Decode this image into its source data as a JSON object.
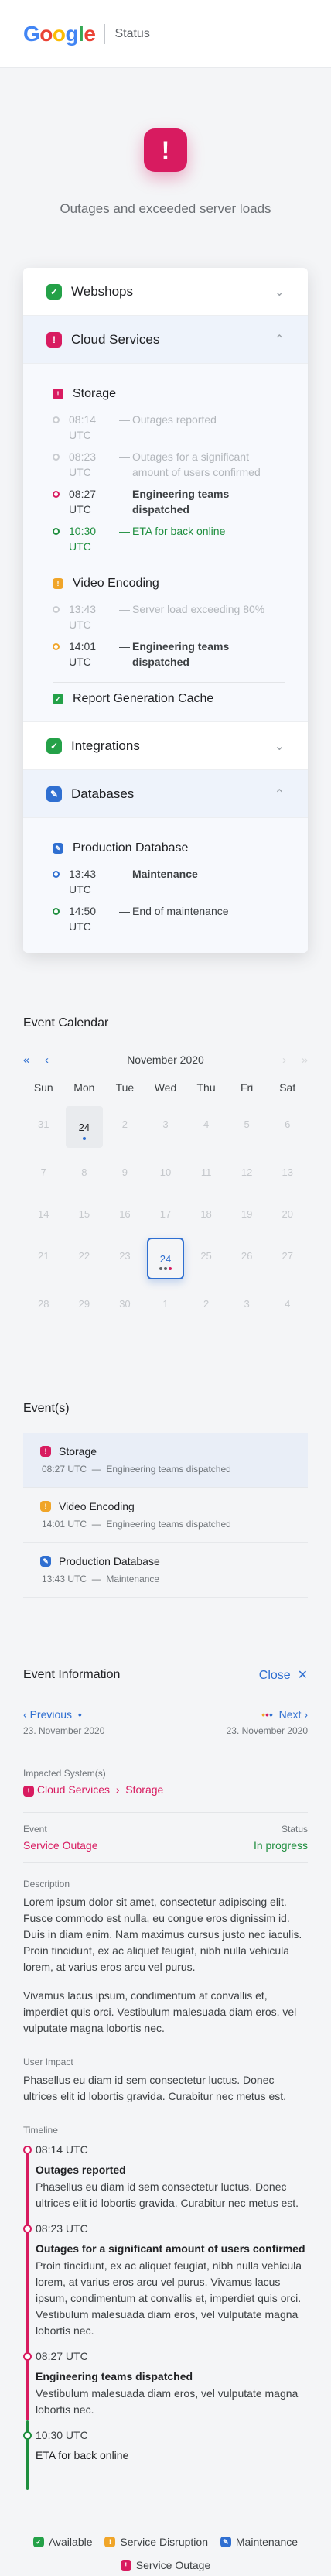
{
  "header": {
    "logo": "Google",
    "title": "Status"
  },
  "logo_colors": [
    "#4285F4",
    "#EA4335",
    "#FBBC05",
    "#4285F4",
    "#34A853",
    "#EA4335"
  ],
  "hero": {
    "icon_text": "!",
    "message": "Outages and exceeded server loads"
  },
  "services": [
    {
      "name": "Webshops",
      "status": "ok",
      "icon": "check-icon",
      "open": false
    },
    {
      "name": "Cloud Services",
      "status": "outage",
      "icon": "exclamation-icon",
      "open": true
    },
    {
      "name": "Integrations",
      "status": "ok",
      "icon": "check-icon",
      "open": false
    },
    {
      "name": "Databases",
      "status": "maintenance",
      "icon": "wrench-icon",
      "open": true
    }
  ],
  "cloud": {
    "storage": {
      "name": "Storage",
      "events": [
        {
          "time": "08:14 UTC",
          "text": "Outages reported"
        },
        {
          "time": "08:23 UTC",
          "text": "Outages for a significant amount of users confirmed"
        },
        {
          "time": "08:27 UTC",
          "text": "Engineering teams dispatched"
        },
        {
          "time": "10:30 UTC",
          "text": "ETA for back online"
        }
      ]
    },
    "video": {
      "name": "Video Encoding",
      "events": [
        {
          "time": "13:43 UTC",
          "text": "Server load exceeding 80%"
        },
        {
          "time": "14:01 UTC",
          "text": "Engineering teams dispatched"
        }
      ]
    },
    "report": {
      "name": "Report Generation Cache"
    }
  },
  "databases": {
    "prod": {
      "name": "Production Database",
      "events": [
        {
          "time": "13:43 UTC",
          "text": "Maintenance"
        },
        {
          "time": "14:50 UTC",
          "text": "End of maintenance"
        }
      ]
    }
  },
  "calendar": {
    "title": "Event Calendar",
    "month": "November 2020",
    "nav": {
      "first": "«",
      "prev": "‹",
      "next": "›",
      "last": "»"
    },
    "weekdays": [
      "Sun",
      "Mon",
      "Tue",
      "Wed",
      "Thu",
      "Fri",
      "Sat"
    ],
    "rows": [
      [
        "31",
        "24",
        "2",
        "3",
        "4",
        "5",
        "6"
      ],
      [
        "7",
        "8",
        "9",
        "10",
        "11",
        "12",
        "13"
      ],
      [
        "14",
        "15",
        "16",
        "17",
        "18",
        "19",
        "20"
      ],
      [
        "21",
        "22",
        "23",
        "24",
        "25",
        "26",
        "27"
      ],
      [
        "28",
        "29",
        "30",
        "1",
        "2",
        "3",
        "4"
      ]
    ]
  },
  "events_section": {
    "title": "Event(s)",
    "items": [
      {
        "name": "Storage",
        "time": "08:27 UTC",
        "text": "Engineering teams dispatched",
        "status": "outage"
      },
      {
        "name": "Video Encoding",
        "time": "14:01 UTC",
        "text": "Engineering teams dispatched",
        "status": "disruption"
      },
      {
        "name": "Production Database",
        "time": "13:43 UTC",
        "text": "Maintenance",
        "status": "maintenance"
      }
    ]
  },
  "info": {
    "title": "Event Information",
    "close": "Close",
    "prev": {
      "label": "Previous",
      "date": "23. November 2020"
    },
    "next": {
      "label": "Next",
      "date": "23. November 2020"
    },
    "impacted_label": "Impacted System(s)",
    "impacted_system": "Cloud Services",
    "impacted_sub": "Storage",
    "event_label": "Event",
    "event_value": "Service Outage",
    "status_label": "Status",
    "status_value": "In progress",
    "description_label": "Description",
    "description_1": "Lorem ipsum dolor sit amet, consectetur adipiscing elit. Fusce commodo est nulla, eu congue eros dignissim id. Duis in diam enim. Nam maximus cursus justo nec iaculis. Proin tincidunt, ex ac aliquet feugiat, nibh nulla vehicula lorem, at varius eros arcu vel purus.",
    "description_2": "Vivamus lacus ipsum, condimentum at convallis et, imperdiet quis orci. Vestibulum malesuada diam eros, vel vulputate magna lobortis nec.",
    "impact_label": "User Impact",
    "impact": "Phasellus eu diam id sem consectetur luctus. Donec ultrices elit id lobortis gravida. Curabitur nec metus est.",
    "timeline_label": "Timeline",
    "timeline": [
      {
        "time": "08:14 UTC",
        "title": "Outages reported",
        "text": "Phasellus eu diam id sem consectetur luctus. Donec ultrices elit id lobortis gravida. Curabitur nec metus est."
      },
      {
        "time": "08:23 UTC",
        "title": "Outages for a significant amount of users confirmed",
        "text": "Proin tincidunt, ex ac aliquet feugiat, nibh nulla vehicula lorem, at varius eros arcu vel purus. Vivamus lacus ipsum, condimentum at convallis et, imperdiet quis orci. Vestibulum malesuada diam eros, vel vulputate magna lobortis nec."
      },
      {
        "time": "08:27 UTC",
        "title": "Engineering teams dispatched",
        "text": "Vestibulum malesuada diam eros, vel vulputate magna lobortis nec."
      },
      {
        "time": "10:30 UTC",
        "title": "ETA for back online",
        "text": ""
      }
    ]
  },
  "legend": {
    "available": "Available",
    "disruption": "Service Disruption",
    "maintenance": "Maintenance",
    "outage": "Service Outage"
  },
  "colors": {
    "ok": "#24a148",
    "disruption": "#f0a529",
    "maintenance": "#2f6fd1",
    "outage": "#d81b60"
  }
}
